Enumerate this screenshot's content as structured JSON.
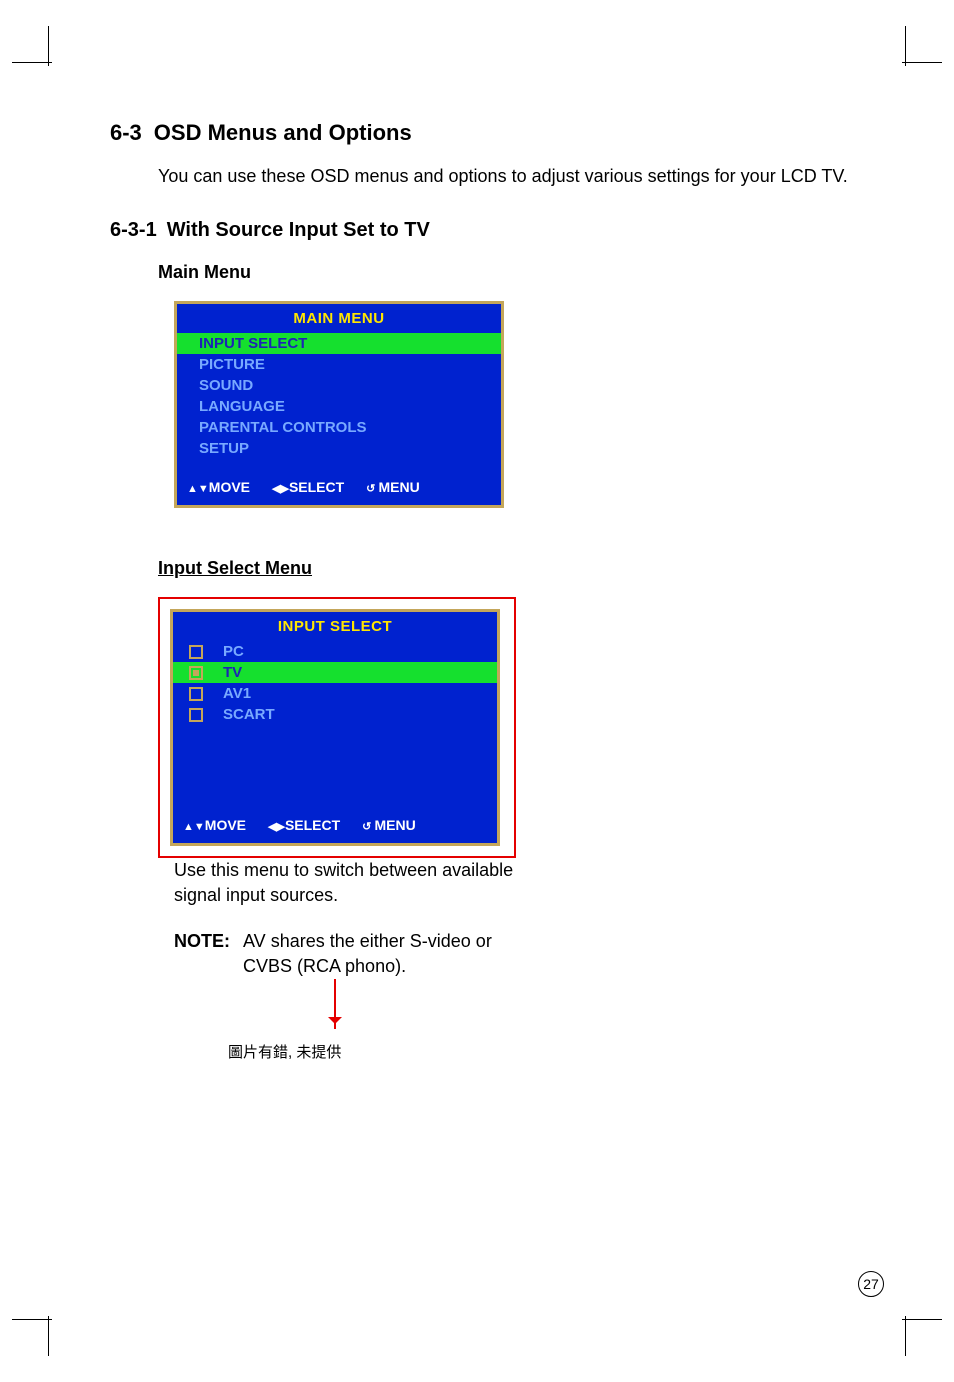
{
  "section": {
    "number": "6-3",
    "title": "OSD Menus and Options"
  },
  "intro": "You can use these OSD menus and options to adjust various settings for your LCD TV.",
  "subsection": {
    "number": "6-3-1",
    "title": "With Source Input Set to TV"
  },
  "mainmenu": {
    "label": "Main Menu",
    "title": "MAIN MENU",
    "items": [
      "INPUT SELECT",
      "PICTURE",
      "SOUND",
      "LANGUAGE",
      "PARENTAL CONTROLS",
      "SETUP"
    ],
    "footer": {
      "move": "MOVE",
      "select": "SELECT",
      "menu": "MENU"
    }
  },
  "inputmenu": {
    "label": "Input Select Menu",
    "title": "INPUT SELECT",
    "items": [
      {
        "label": "PC",
        "checked": false,
        "selected": false
      },
      {
        "label": "TV",
        "checked": true,
        "selected": true
      },
      {
        "label": "AV1",
        "checked": false,
        "selected": false
      },
      {
        "label": "SCART",
        "checked": false,
        "selected": false
      }
    ],
    "footer": {
      "move": "MOVE",
      "select": "SELECT",
      "menu": "MENU"
    },
    "description": "Use this menu to switch between available signal input sources.",
    "note_label": "NOTE:",
    "note_text": "AV shares the either S-video or CVBS (RCA phono)."
  },
  "caption_cn": "圖片有錯, 未提供",
  "page_number": "27"
}
